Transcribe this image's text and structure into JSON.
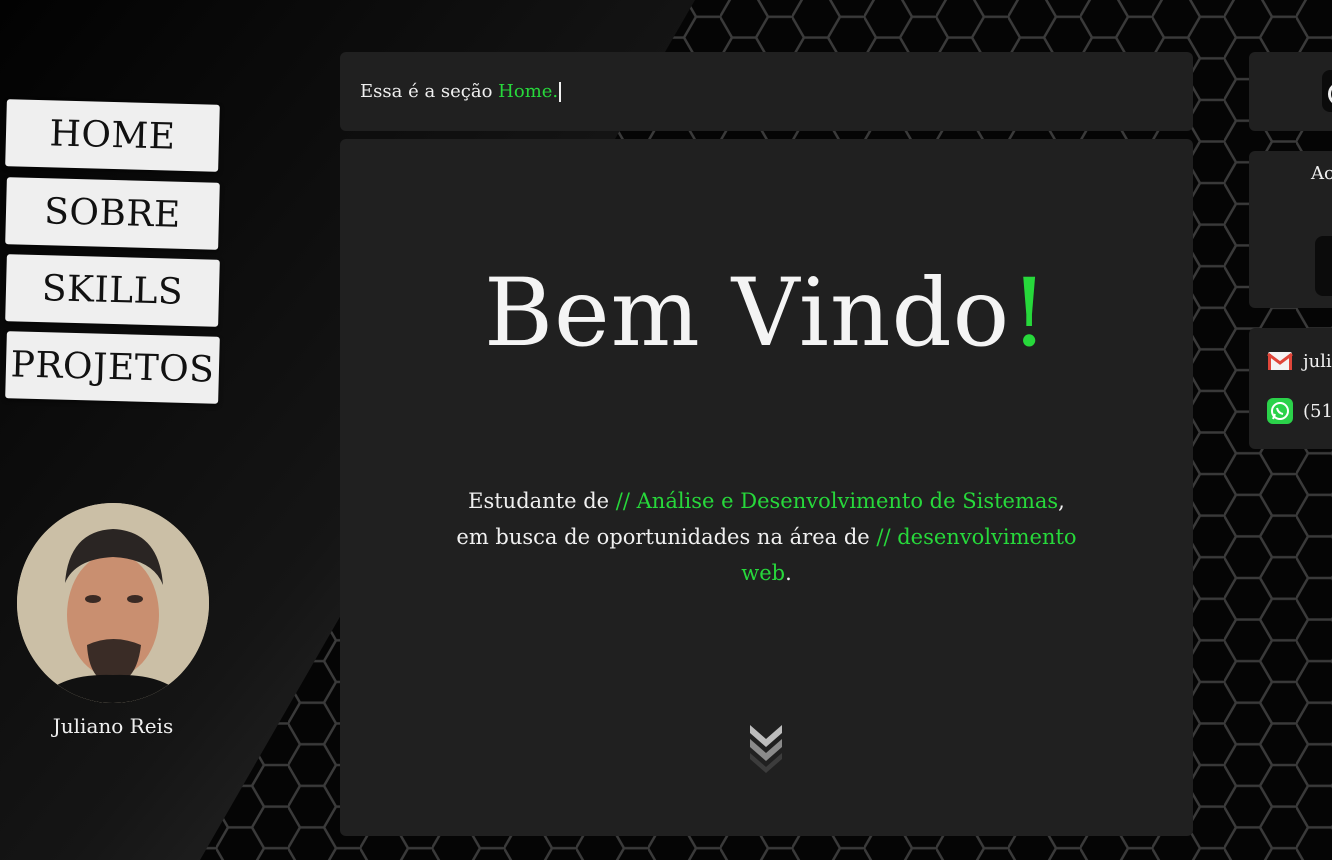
{
  "nav": {
    "items": [
      {
        "label": "HOME"
      },
      {
        "label": "SOBRE"
      },
      {
        "label": "SKILLS"
      },
      {
        "label": "PROJETOS"
      }
    ]
  },
  "profile": {
    "name": "Juliano Reis"
  },
  "section_bar": {
    "prefix": "Essa é a seção ",
    "section_name": "Home."
  },
  "hero": {
    "title": "Bem Vindo",
    "exclamation": "!",
    "desc_1": "Estudante de ",
    "desc_highlight_1": "// Análise e Desenvolvimento de Sistemas",
    "desc_2": ", em busca de oportunidades na área de ",
    "desc_highlight_2": "// desenvolvimento web",
    "desc_3": "."
  },
  "right_panel": {
    "card_text": "Ac",
    "email": "julia",
    "phone": "(51"
  },
  "icons": {
    "scroll": "chevron-double-down-icon",
    "email": "gmail-icon",
    "whatsapp": "whatsapp-icon"
  },
  "colors": {
    "accent": "#27d83b",
    "panel": "#202020",
    "background": "#060606",
    "nav_button": "#efefef"
  }
}
